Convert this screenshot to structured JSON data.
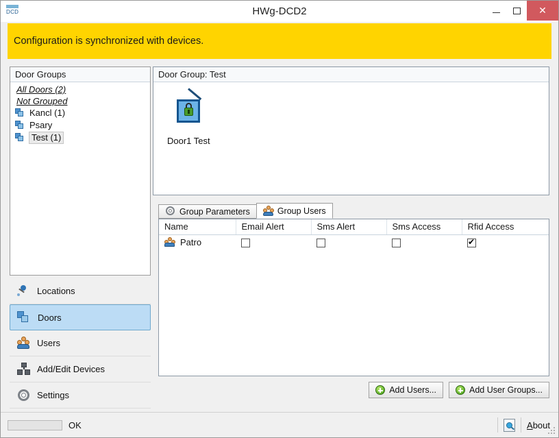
{
  "window": {
    "title": "HWg-DCD2",
    "app_icon_text": "DCD",
    "minimize_label": "–",
    "maximize_label": "❑",
    "close_label": "✕"
  },
  "banner": {
    "text": "Configuration is synchronized with devices."
  },
  "tree": {
    "header": "Door Groups",
    "links": [
      {
        "label": "All Doors (2)"
      },
      {
        "label": "Not Grouped"
      }
    ],
    "items": [
      {
        "label": "Kancl (1)",
        "selected": false
      },
      {
        "label": "Psary",
        "selected": false
      },
      {
        "label": "Test (1)",
        "selected": true
      }
    ]
  },
  "nav": {
    "items": [
      {
        "label": "Locations",
        "icon": "pin-icon",
        "active": false
      },
      {
        "label": "Doors",
        "icon": "doors-icon",
        "active": true
      },
      {
        "label": "Users",
        "icon": "users-icon",
        "active": false
      },
      {
        "label": "Add/Edit Devices",
        "icon": "devices-icon",
        "active": false
      },
      {
        "label": "Settings",
        "icon": "gear-icon",
        "active": false
      }
    ]
  },
  "door_group": {
    "header": "Door Group: Test",
    "door": {
      "label": "Door1 Test",
      "icon": "door-lock-icon"
    }
  },
  "tabs": [
    {
      "label": "Group Parameters",
      "icon": "gear-icon",
      "active": false
    },
    {
      "label": "Group Users",
      "icon": "users-icon",
      "active": true
    }
  ],
  "grid": {
    "columns": [
      "Name",
      "Email Alert",
      "Sms Alert",
      "Sms Access",
      "Rfid Access"
    ],
    "rows": [
      {
        "name": "Patro",
        "email_alert": false,
        "sms_alert": false,
        "sms_access": false,
        "rfid_access": true
      }
    ]
  },
  "actions": {
    "add_users": "Add Users...",
    "add_user_groups": "Add User Groups..."
  },
  "statusbar": {
    "status_text": "OK",
    "about_label": "About",
    "about_icon": "magnifier-icon"
  },
  "colors": {
    "banner": "#ffd400",
    "accent": "#4e92cf",
    "selection": "#bcdcf5",
    "close_button": "#d1595e"
  }
}
